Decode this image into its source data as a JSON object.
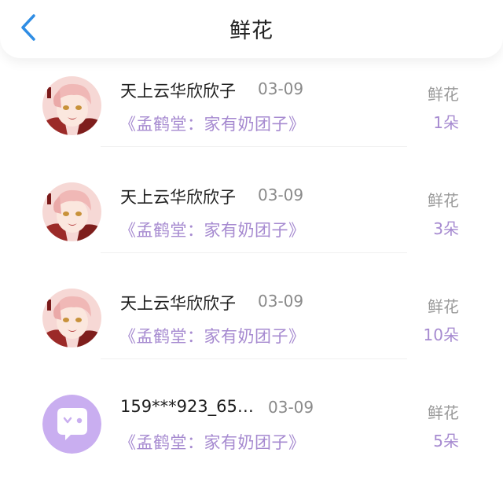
{
  "header": {
    "title": "鲜花"
  },
  "items": [
    {
      "name": "天上云华欣欣子",
      "date": "03-09",
      "book": "《孟鹤堂：家有奶团子》",
      "gift": "鲜花",
      "count": "1朵",
      "avatar": "anime-avatar"
    },
    {
      "name": "天上云华欣欣子",
      "date": "03-09",
      "book": "《孟鹤堂：家有奶团子》",
      "gift": "鲜花",
      "count": "3朵",
      "avatar": "anime-avatar"
    },
    {
      "name": "天上云华欣欣子",
      "date": "03-09",
      "book": "《孟鹤堂：家有奶团子》",
      "gift": "鲜花",
      "count": "10朵",
      "avatar": "anime-avatar"
    },
    {
      "name": "159***923_65…",
      "date": "03-09",
      "book": "《孟鹤堂：家有奶团子》",
      "gift": "鲜花",
      "count": "5朵",
      "avatar": "default-chat-avatar"
    }
  ],
  "colors": {
    "accent": "#a68ad0",
    "back": "#2f8de4",
    "default_avatar": "#c9aef0"
  }
}
